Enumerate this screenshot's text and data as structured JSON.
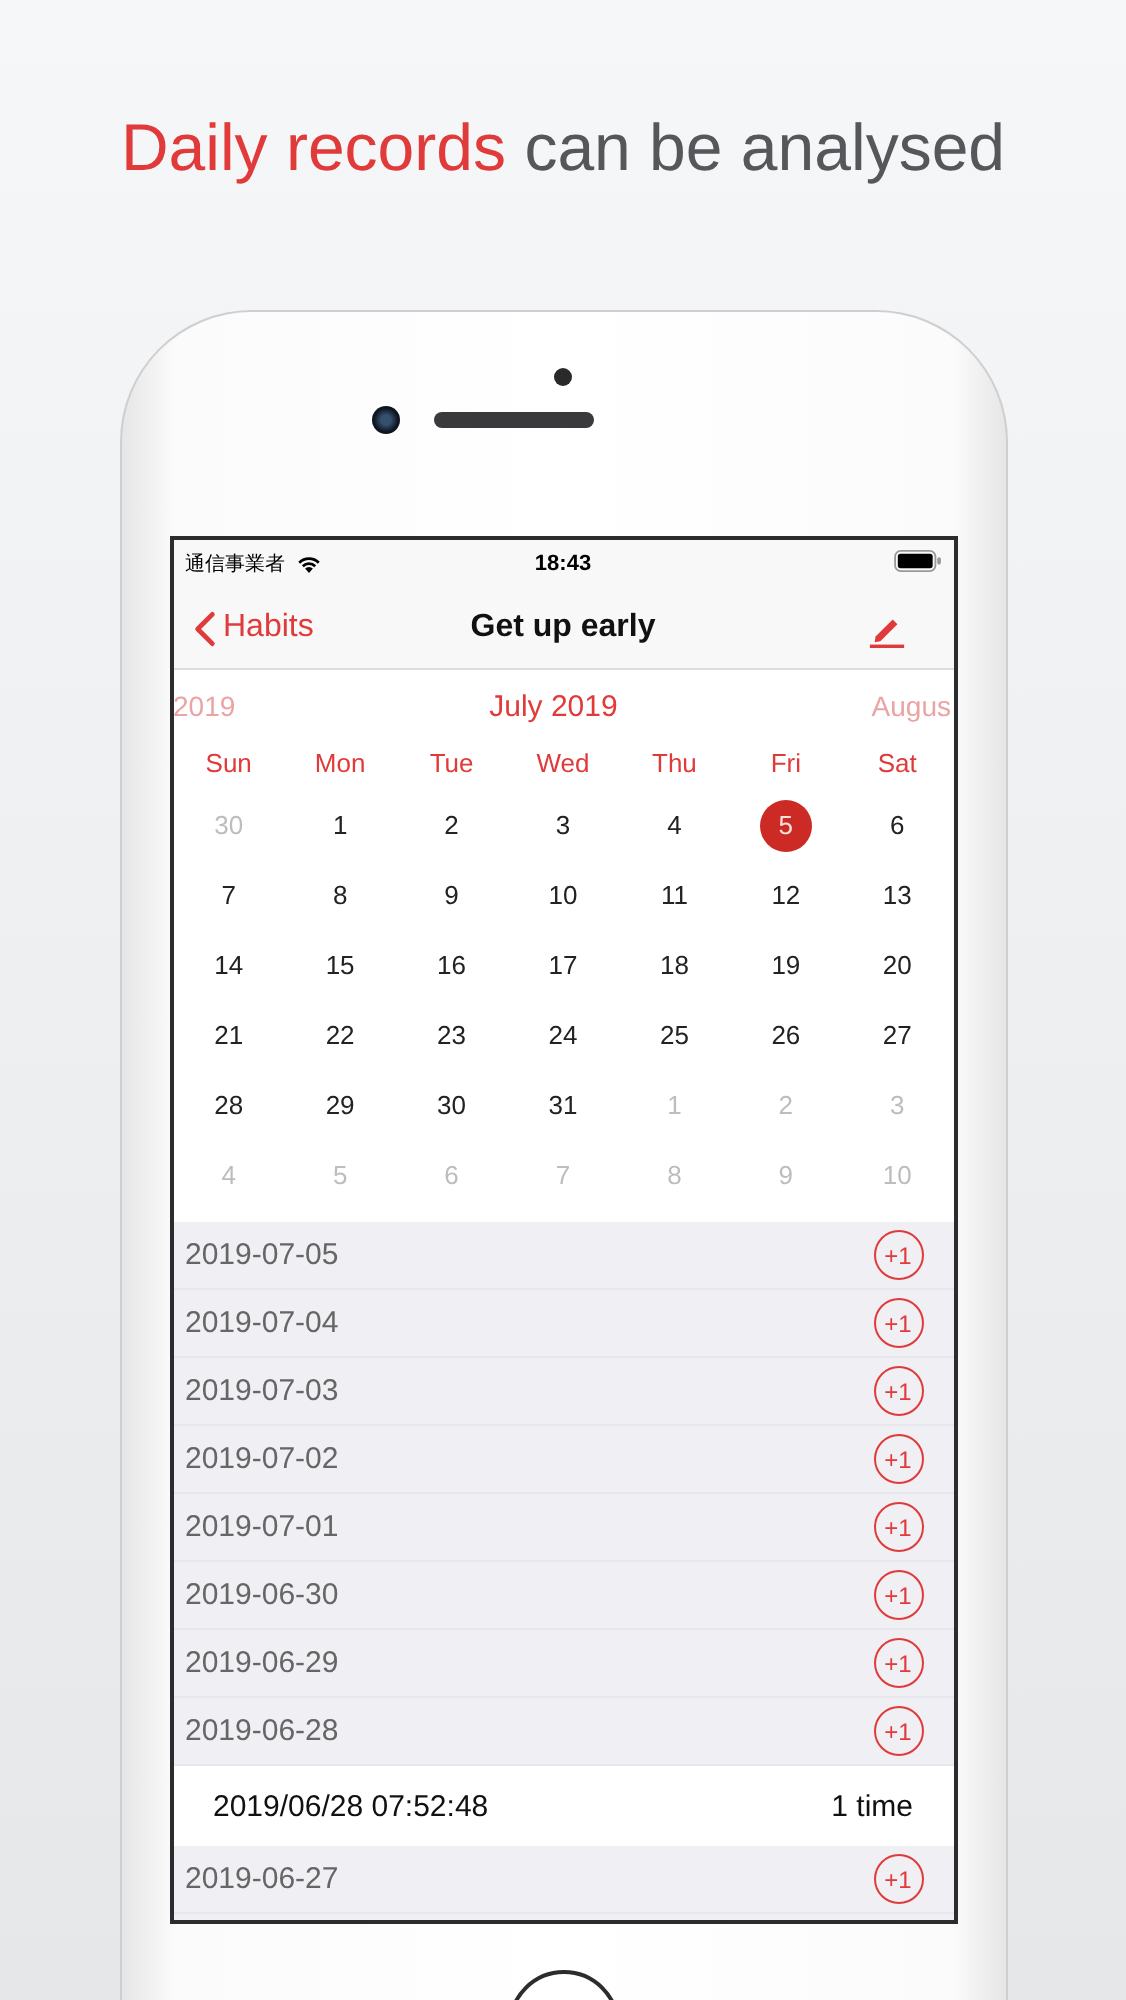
{
  "headline": {
    "highlight": "Daily records",
    "rest": "can be analysed"
  },
  "status_bar": {
    "carrier": "通信事業者",
    "time": "18:43"
  },
  "nav": {
    "back": "Habits",
    "title": "Get up early"
  },
  "calendar": {
    "prev_month": "2019",
    "month": "July 2019",
    "next_month": "Augus",
    "weekdays": [
      "Sun",
      "Mon",
      "Tue",
      "Wed",
      "Thu",
      "Fri",
      "Sat"
    ],
    "weeks": [
      [
        {
          "day": "30",
          "in_month": false,
          "selected": false
        },
        {
          "day": "1",
          "in_month": true,
          "selected": false
        },
        {
          "day": "2",
          "in_month": true,
          "selected": false
        },
        {
          "day": "3",
          "in_month": true,
          "selected": false
        },
        {
          "day": "4",
          "in_month": true,
          "selected": false
        },
        {
          "day": "5",
          "in_month": true,
          "selected": true
        },
        {
          "day": "6",
          "in_month": true,
          "selected": false
        }
      ],
      [
        {
          "day": "7",
          "in_month": true,
          "selected": false
        },
        {
          "day": "8",
          "in_month": true,
          "selected": false
        },
        {
          "day": "9",
          "in_month": true,
          "selected": false
        },
        {
          "day": "10",
          "in_month": true,
          "selected": false
        },
        {
          "day": "11",
          "in_month": true,
          "selected": false
        },
        {
          "day": "12",
          "in_month": true,
          "selected": false
        },
        {
          "day": "13",
          "in_month": true,
          "selected": false
        }
      ],
      [
        {
          "day": "14",
          "in_month": true,
          "selected": false
        },
        {
          "day": "15",
          "in_month": true,
          "selected": false
        },
        {
          "day": "16",
          "in_month": true,
          "selected": false
        },
        {
          "day": "17",
          "in_month": true,
          "selected": false
        },
        {
          "day": "18",
          "in_month": true,
          "selected": false
        },
        {
          "day": "19",
          "in_month": true,
          "selected": false
        },
        {
          "day": "20",
          "in_month": true,
          "selected": false
        }
      ],
      [
        {
          "day": "21",
          "in_month": true,
          "selected": false
        },
        {
          "day": "22",
          "in_month": true,
          "selected": false
        },
        {
          "day": "23",
          "in_month": true,
          "selected": false
        },
        {
          "day": "24",
          "in_month": true,
          "selected": false
        },
        {
          "day": "25",
          "in_month": true,
          "selected": false
        },
        {
          "day": "26",
          "in_month": true,
          "selected": false
        },
        {
          "day": "27",
          "in_month": true,
          "selected": false
        }
      ],
      [
        {
          "day": "28",
          "in_month": true,
          "selected": false
        },
        {
          "day": "29",
          "in_month": true,
          "selected": false
        },
        {
          "day": "30",
          "in_month": true,
          "selected": false
        },
        {
          "day": "31",
          "in_month": true,
          "selected": false
        },
        {
          "day": "1",
          "in_month": false,
          "selected": false
        },
        {
          "day": "2",
          "in_month": false,
          "selected": false
        },
        {
          "day": "3",
          "in_month": false,
          "selected": false
        }
      ],
      [
        {
          "day": "4",
          "in_month": false,
          "selected": false
        },
        {
          "day": "5",
          "in_month": false,
          "selected": false
        },
        {
          "day": "6",
          "in_month": false,
          "selected": false
        },
        {
          "day": "7",
          "in_month": false,
          "selected": false
        },
        {
          "day": "8",
          "in_month": false,
          "selected": false
        },
        {
          "day": "9",
          "in_month": false,
          "selected": false
        },
        {
          "day": "10",
          "in_month": false,
          "selected": false
        }
      ]
    ]
  },
  "records": [
    {
      "date": "2019-07-05",
      "button": "+1"
    },
    {
      "date": "2019-07-04",
      "button": "+1"
    },
    {
      "date": "2019-07-03",
      "button": "+1"
    },
    {
      "date": "2019-07-02",
      "button": "+1"
    },
    {
      "date": "2019-07-01",
      "button": "+1"
    },
    {
      "date": "2019-06-30",
      "button": "+1"
    },
    {
      "date": "2019-06-29",
      "button": "+1"
    },
    {
      "date": "2019-06-28",
      "button": "+1",
      "entries": [
        {
          "time": "2019/06/28 07:52:48",
          "count": "1 time"
        }
      ]
    },
    {
      "date": "2019-06-27",
      "button": "+1"
    }
  ]
}
